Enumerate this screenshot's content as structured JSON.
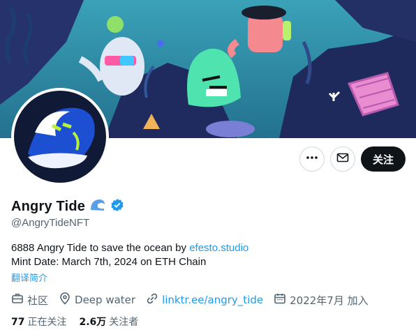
{
  "profile": {
    "display_name": "Angry Tide",
    "handle": "@AngryTideNFT",
    "verified": true,
    "name_emoji_icon": "wave-icon",
    "bio_line1_text": "6888 Angry Tide to save the ocean by ",
    "bio_line1_link": "efesto.studio",
    "bio_line2": "Mint Date: March 7th, 2024 on ETH Chain",
    "translate_label": "翻译简介"
  },
  "meta": {
    "category": "社区",
    "location": "Deep water",
    "website": "linktr.ee/angry_tide",
    "joined": "2022年7月 加入"
  },
  "stats": {
    "following_count": "77",
    "following_label": "正在关注",
    "followers_count": "2.6万",
    "followers_label": "关注者"
  },
  "actions": {
    "more_icon": "more-icon",
    "message_icon": "mail-icon",
    "follow_label": "关注"
  },
  "colors": {
    "accent": "#1d9bf0",
    "text": "#0f1419",
    "muted": "#536471",
    "follow_bg": "#0f1419"
  }
}
